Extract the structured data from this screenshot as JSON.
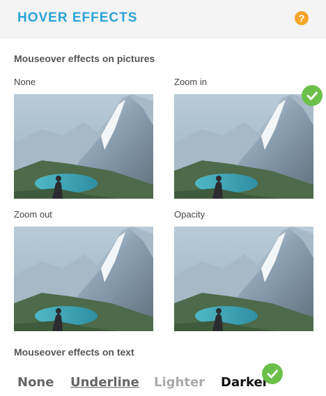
{
  "header": {
    "title": "HOVER EFFECTS",
    "help_label": "?"
  },
  "pictures_section": {
    "title": "Mouseover effects on pictures",
    "options": [
      {
        "label": "None",
        "selected": false
      },
      {
        "label": "Zoom in",
        "selected": true
      },
      {
        "label": "Zoom out",
        "selected": false
      },
      {
        "label": "Opacity",
        "selected": false
      }
    ]
  },
  "text_section": {
    "title": "Mouseover effects on text",
    "options": [
      {
        "label": "None",
        "selected": false,
        "color": "#666666"
      },
      {
        "label": "Underline",
        "selected": false,
        "color": "#666666"
      },
      {
        "label": "Lighter",
        "selected": false,
        "color": "#aaaaaa"
      },
      {
        "label": "Darker",
        "selected": true,
        "color": "#111111"
      }
    ]
  },
  "colors": {
    "accent": "#2aa3d6",
    "help": "#f7a62b",
    "check": "#6cc04a"
  }
}
